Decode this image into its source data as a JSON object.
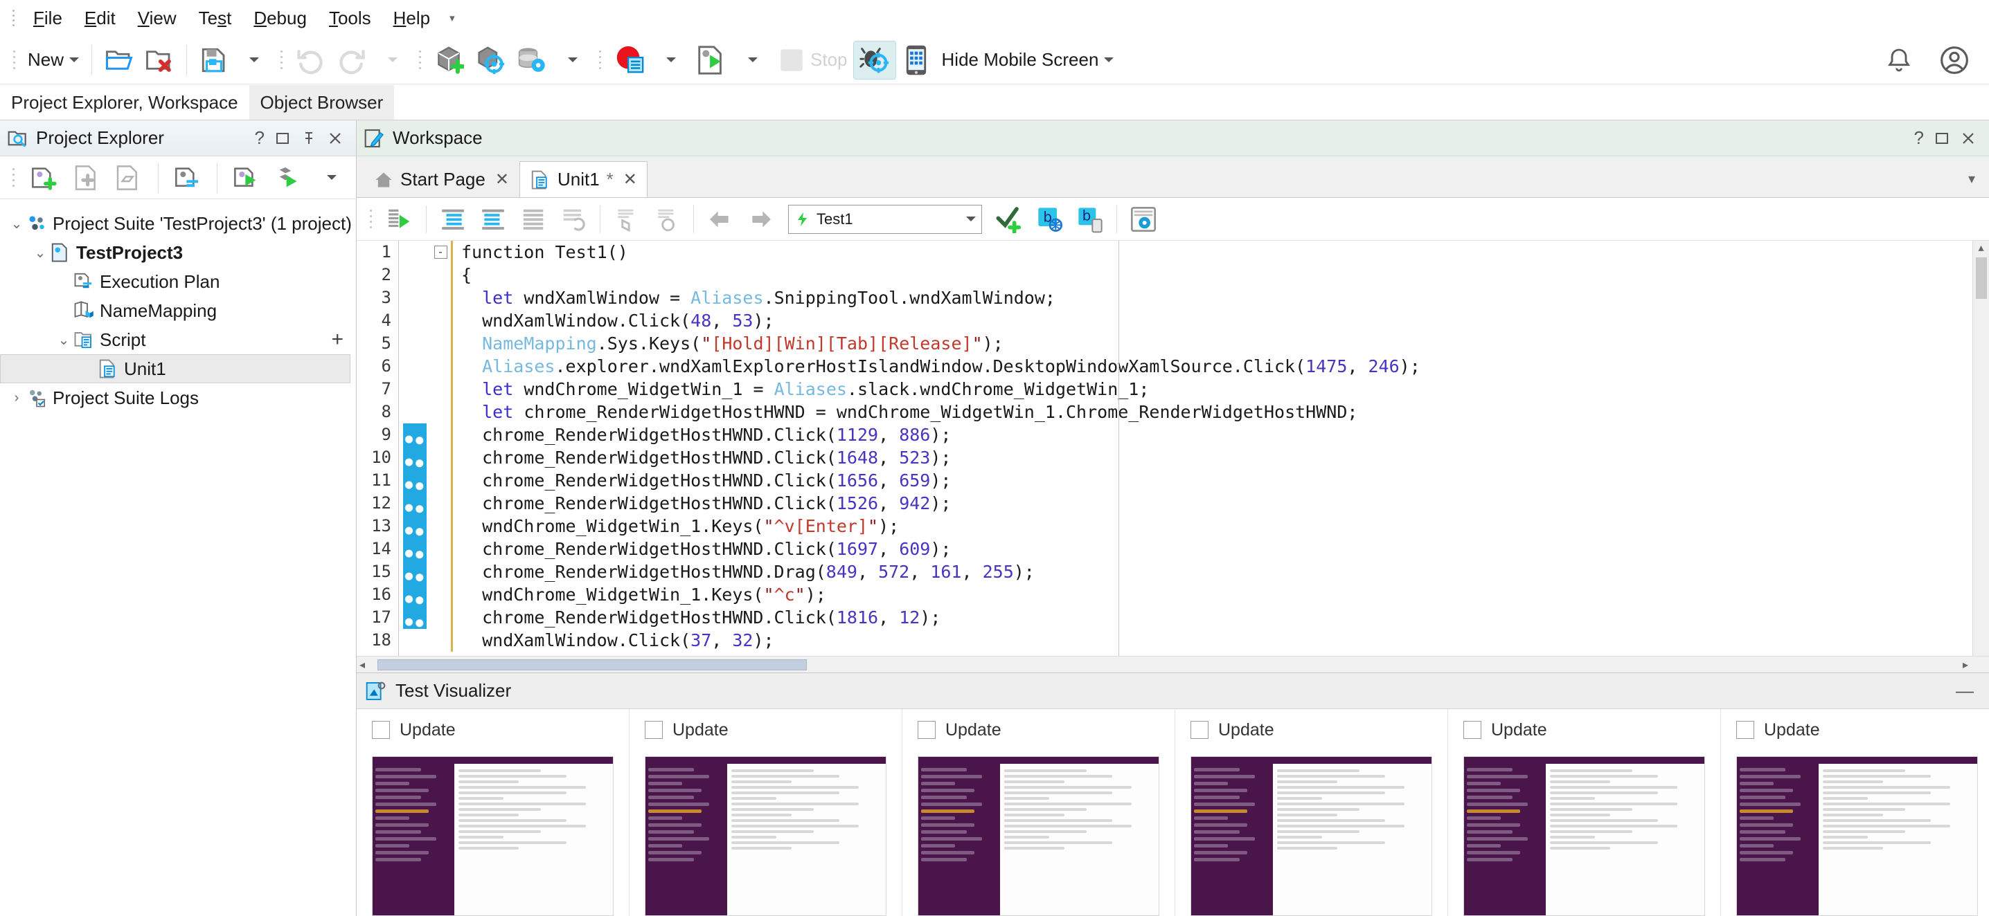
{
  "app": {
    "menu": [
      {
        "label": "File",
        "accel": "F"
      },
      {
        "label": "Edit",
        "accel": "E"
      },
      {
        "label": "View",
        "accel": "V"
      },
      {
        "label": "Test",
        "accel": "s"
      },
      {
        "label": "Debug",
        "accel": "D"
      },
      {
        "label": "Tools",
        "accel": "T"
      },
      {
        "label": "Help",
        "accel": "H"
      }
    ],
    "menu_overflow": "▾"
  },
  "toolbar": {
    "new_label": "New",
    "stop_label": "Stop",
    "hide_mobile_label": "Hide Mobile Screen",
    "icons": {
      "open_project": "open-folder-icon",
      "close_project": "close-folder-icon",
      "save": "save-icon",
      "undo": "undo-icon",
      "redo": "redo-icon",
      "add_object": "add-object-icon",
      "object_spy": "object-spy-icon",
      "database": "database-settings-icon",
      "record": "record-test-icon",
      "run": "run-test-icon",
      "stop": "stop-icon",
      "debug": "debug-bug-icon",
      "mobile": "mobile-device-icon",
      "notifications": "bell-icon",
      "account": "user-account-icon"
    }
  },
  "panel_tabs": [
    {
      "label": "Project Explorer, Workspace",
      "selected": false
    },
    {
      "label": "Object Browser",
      "selected": true
    }
  ],
  "project_explorer": {
    "title": "Project Explorer",
    "header_buttons": [
      "?",
      "▢",
      "📌",
      "✕"
    ],
    "tree": [
      {
        "label": "Project Suite 'TestProject3' (1 project)",
        "depth": 0,
        "twisty": "v",
        "icon": "project-suite-icon",
        "bold": false,
        "selected": false
      },
      {
        "label": "TestProject3",
        "depth": 1,
        "twisty": "v",
        "icon": "project-icon",
        "bold": true,
        "selected": false
      },
      {
        "label": "Execution Plan",
        "depth": 2,
        "twisty": "",
        "icon": "execution-plan-icon",
        "bold": false,
        "selected": false
      },
      {
        "label": "NameMapping",
        "depth": 2,
        "twisty": "",
        "icon": "name-mapping-icon",
        "bold": false,
        "selected": false
      },
      {
        "label": "Script",
        "depth": 2,
        "twisty": "v",
        "icon": "script-folder-icon",
        "bold": false,
        "selected": false,
        "plus": "+"
      },
      {
        "label": "Unit1",
        "depth": 3,
        "twisty": "",
        "icon": "script-unit-icon",
        "bold": false,
        "selected": true
      },
      {
        "label": "Project Suite Logs",
        "depth": 0,
        "twisty": ">",
        "icon": "logs-icon",
        "bold": false,
        "selected": false
      }
    ]
  },
  "workspace": {
    "title": "Workspace",
    "header_buttons": [
      "?",
      "▢",
      "✕"
    ],
    "tabs": [
      {
        "label": "Start Page",
        "selected": false,
        "modified": false,
        "icon": "home-icon"
      },
      {
        "label": "Unit1",
        "selected": true,
        "modified": true,
        "modified_mark": "*",
        "icon": "script-unit-icon"
      }
    ],
    "close_glyph": "✕"
  },
  "editor_toolbar": {
    "test_selector_value": "Test1",
    "icons": [
      "run-script-icon",
      "indent-icon",
      "outdent-icon",
      "comment-icon",
      "uncomment-icon",
      "toggle-bookmark-icon",
      "clear-bookmarks-icon",
      "nav-back-icon",
      "nav-forward-icon",
      "add-checkpoint-icon",
      "browser-icon",
      "browser-mobile-icon",
      "script-options-icon"
    ]
  },
  "code": {
    "language": "JavaScript",
    "lines": [
      {
        "n": 1,
        "fold": "-",
        "mark": false,
        "tokens": [
          [
            "k-fn",
            "function "
          ],
          [
            "k-plain",
            "Test1()"
          ]
        ]
      },
      {
        "n": 2,
        "fold": "",
        "mark": false,
        "tokens": [
          [
            "k-plain",
            "{"
          ]
        ]
      },
      {
        "n": 3,
        "fold": "",
        "mark": false,
        "tokens": [
          [
            "k-plain",
            "  "
          ],
          [
            "k-let",
            "let "
          ],
          [
            "k-plain",
            "wndXamlWindow = "
          ],
          [
            "k-alias",
            "Aliases"
          ],
          [
            "k-plain",
            ".SnippingTool.wndXamlWindow;"
          ]
        ]
      },
      {
        "n": 4,
        "fold": "",
        "mark": false,
        "tokens": [
          [
            "k-plain",
            "  wndXamlWindow.Click("
          ],
          [
            "k-num",
            "48"
          ],
          [
            "k-plain",
            ", "
          ],
          [
            "k-num",
            "53"
          ],
          [
            "k-plain",
            ");"
          ]
        ]
      },
      {
        "n": 5,
        "fold": "",
        "mark": false,
        "tokens": [
          [
            "k-plain",
            "  "
          ],
          [
            "k-alias",
            "NameMapping"
          ],
          [
            "k-plain",
            ".Sys.Keys("
          ],
          [
            "k-str",
            "\""
          ],
          [
            "k-keys",
            "[Hold][Win][Tab][Release]"
          ],
          [
            "k-str",
            "\""
          ],
          [
            "k-plain",
            ");"
          ]
        ]
      },
      {
        "n": 6,
        "fold": "",
        "mark": false,
        "tokens": [
          [
            "k-plain",
            "  "
          ],
          [
            "k-alias",
            "Aliases"
          ],
          [
            "k-plain",
            ".explorer.wndXamlExplorerHostIslandWindow.DesktopWindowXamlSource.Click("
          ],
          [
            "k-num",
            "1475"
          ],
          [
            "k-plain",
            ", "
          ],
          [
            "k-num",
            "246"
          ],
          [
            "k-plain",
            ");"
          ]
        ]
      },
      {
        "n": 7,
        "fold": "",
        "mark": false,
        "tokens": [
          [
            "k-plain",
            "  "
          ],
          [
            "k-let",
            "let "
          ],
          [
            "k-plain",
            "wndChrome_WidgetWin_1 = "
          ],
          [
            "k-alias",
            "Aliases"
          ],
          [
            "k-plain",
            ".slack.wndChrome_WidgetWin_1;"
          ]
        ]
      },
      {
        "n": 8,
        "fold": "",
        "mark": false,
        "tokens": [
          [
            "k-plain",
            "  "
          ],
          [
            "k-let",
            "let "
          ],
          [
            "k-plain",
            "chrome_RenderWidgetHostHWND = wndChrome_WidgetWin_1.Chrome_RenderWidgetHostHWND;"
          ]
        ]
      },
      {
        "n": 9,
        "fold": "",
        "mark": true,
        "tokens": [
          [
            "k-plain",
            "  chrome_RenderWidgetHostHWND.Click("
          ],
          [
            "k-num",
            "1129"
          ],
          [
            "k-plain",
            ", "
          ],
          [
            "k-num",
            "886"
          ],
          [
            "k-plain",
            ");"
          ]
        ]
      },
      {
        "n": 10,
        "fold": "",
        "mark": true,
        "tokens": [
          [
            "k-plain",
            "  chrome_RenderWidgetHostHWND.Click("
          ],
          [
            "k-num",
            "1648"
          ],
          [
            "k-plain",
            ", "
          ],
          [
            "k-num",
            "523"
          ],
          [
            "k-plain",
            ");"
          ]
        ]
      },
      {
        "n": 11,
        "fold": "",
        "mark": true,
        "tokens": [
          [
            "k-plain",
            "  chrome_RenderWidgetHostHWND.Click("
          ],
          [
            "k-num",
            "1656"
          ],
          [
            "k-plain",
            ", "
          ],
          [
            "k-num",
            "659"
          ],
          [
            "k-plain",
            ");"
          ]
        ]
      },
      {
        "n": 12,
        "fold": "",
        "mark": true,
        "tokens": [
          [
            "k-plain",
            "  chrome_RenderWidgetHostHWND.Click("
          ],
          [
            "k-num",
            "1526"
          ],
          [
            "k-plain",
            ", "
          ],
          [
            "k-num",
            "942"
          ],
          [
            "k-plain",
            ");"
          ]
        ]
      },
      {
        "n": 13,
        "fold": "",
        "mark": true,
        "tokens": [
          [
            "k-plain",
            "  wndChrome_WidgetWin_1.Keys("
          ],
          [
            "k-str",
            "\""
          ],
          [
            "k-keys",
            "^v[Enter]"
          ],
          [
            "k-str",
            "\""
          ],
          [
            "k-plain",
            ");"
          ]
        ]
      },
      {
        "n": 14,
        "fold": "",
        "mark": true,
        "tokens": [
          [
            "k-plain",
            "  chrome_RenderWidgetHostHWND.Click("
          ],
          [
            "k-num",
            "1697"
          ],
          [
            "k-plain",
            ", "
          ],
          [
            "k-num",
            "609"
          ],
          [
            "k-plain",
            ");"
          ]
        ]
      },
      {
        "n": 15,
        "fold": "",
        "mark": true,
        "tokens": [
          [
            "k-plain",
            "  chrome_RenderWidgetHostHWND.Drag("
          ],
          [
            "k-num",
            "849"
          ],
          [
            "k-plain",
            ", "
          ],
          [
            "k-num",
            "572"
          ],
          [
            "k-plain",
            ", "
          ],
          [
            "k-num",
            "161"
          ],
          [
            "k-plain",
            ", "
          ],
          [
            "k-num",
            "255"
          ],
          [
            "k-plain",
            ");"
          ]
        ]
      },
      {
        "n": 16,
        "fold": "",
        "mark": true,
        "tokens": [
          [
            "k-plain",
            "  wndChrome_WidgetWin_1.Keys("
          ],
          [
            "k-str",
            "\""
          ],
          [
            "k-keys",
            "^c"
          ],
          [
            "k-str",
            "\""
          ],
          [
            "k-plain",
            ");"
          ]
        ]
      },
      {
        "n": 17,
        "fold": "",
        "mark": true,
        "tokens": [
          [
            "k-plain",
            "  chrome_RenderWidgetHostHWND.Click("
          ],
          [
            "k-num",
            "1816"
          ],
          [
            "k-plain",
            ", "
          ],
          [
            "k-num",
            "12"
          ],
          [
            "k-plain",
            ");"
          ]
        ]
      },
      {
        "n": 18,
        "fold": "",
        "mark": false,
        "tokens": [
          [
            "k-plain",
            "  wndXamlWindow.Click("
          ],
          [
            "k-num",
            "37"
          ],
          [
            "k-plain",
            ", "
          ],
          [
            "k-num",
            "32"
          ],
          [
            "k-plain",
            ");"
          ]
        ]
      }
    ]
  },
  "test_visualizer": {
    "title": "Test Visualizer",
    "minimize_glyph": "—",
    "cards": [
      {
        "label": "Update",
        "checked": false
      },
      {
        "label": "Update",
        "checked": false
      },
      {
        "label": "Update",
        "checked": false
      },
      {
        "label": "Update",
        "checked": false
      },
      {
        "label": "Update",
        "checked": false
      },
      {
        "label": "Update",
        "checked": false
      }
    ]
  },
  "colors": {
    "accent_blue": "#23a9e1",
    "workspace_header": "#e6f0e8",
    "panel_header": "#eef3f7",
    "keyword": "#3b2ec9",
    "alias": "#76b9e0",
    "number": "#4b32c3",
    "string_key": "#c0392b",
    "slack_purple": "#4a154b"
  }
}
